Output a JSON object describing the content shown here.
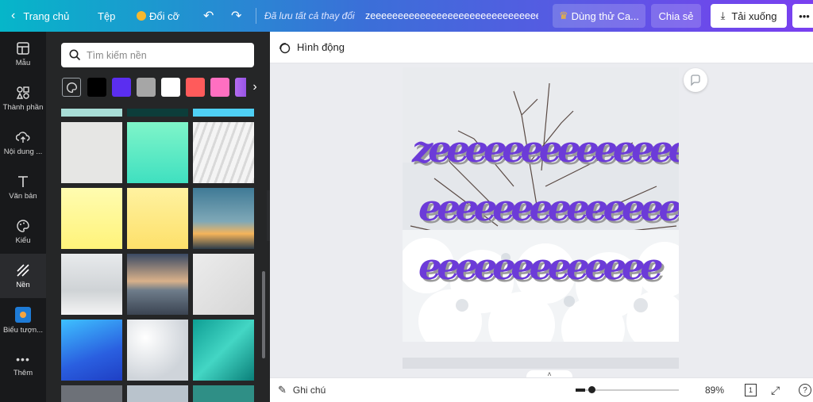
{
  "topbar": {
    "home": "Trang chủ",
    "file": "Tệp",
    "resize": "Đổi cỡ",
    "saved": "Đã lưu tất cả thay đổi",
    "title": "zeeeeeeeeeeeeeeeeeeeeeeeeeeeeeee...",
    "try": "Dùng thử Ca...",
    "share": "Chia sẻ",
    "download": "Tải xuống",
    "more": "•••"
  },
  "rail": {
    "items": [
      {
        "label": "Mẫu",
        "icon": "template-icon"
      },
      {
        "label": "Thành phần",
        "icon": "elements-icon"
      },
      {
        "label": "Nội dung ...",
        "icon": "upload-icon"
      },
      {
        "label": "Văn bản",
        "icon": "text-icon"
      },
      {
        "label": "Kiểu",
        "icon": "palette-icon"
      },
      {
        "label": "Nền",
        "icon": "background-icon"
      },
      {
        "label": "Biểu tượn...",
        "icon": "logo-icon"
      },
      {
        "label": "Thêm",
        "icon": "more-icon"
      }
    ]
  },
  "panel": {
    "search_placeholder": "Tìm kiếm nền",
    "swatches": [
      "#000000",
      "#5b2ef0",
      "#a6a6a6",
      "#ffffff",
      "#ff5b5b",
      "#ff6fc1",
      "#b36cf0"
    ]
  },
  "subbar": {
    "animate": "Hình động"
  },
  "canvas": {
    "text": [
      "zeeeeeeeeeeeeee",
      "eeeeeeeeeeeeeee",
      "eeeeeeeeeeeee"
    ],
    "text_color": "#6c3bd8"
  },
  "bottom": {
    "notes": "Ghi chú",
    "zoom": "89%",
    "zoom_fraction": 0.09,
    "page": "1"
  }
}
